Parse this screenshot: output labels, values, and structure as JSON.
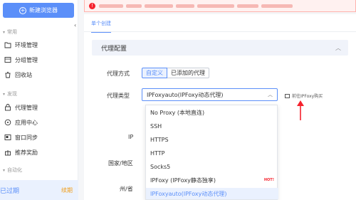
{
  "sidebar": {
    "new_button": "新建浏览器",
    "sections": {
      "common": "常用",
      "discover": "发现",
      "automation": "自动化"
    },
    "items": {
      "env": "环境管理",
      "group": "分组管理",
      "recycle": "回收站",
      "proxy": "代理管理",
      "apps": "应用中心",
      "sync": "窗口同步",
      "referral": "推荐奖励"
    },
    "expire_text": "已过期",
    "renew_label": "续期"
  },
  "main": {
    "tab_label": "单个创建",
    "section_title": "代理配置",
    "proxy_mode_label": "代理方式",
    "proxy_mode_options": [
      "自定义",
      "已添加的代理"
    ],
    "proxy_type_label": "代理类型",
    "proxy_type_value": "IPFoxyauto(IPFoxy动态代理)",
    "buy_link": "前往IPFoxy购买",
    "ip_label": "IP",
    "country_label": "国家/地区",
    "state_label": "州/省",
    "dropdown_options": [
      "No Proxy (本地直连)",
      "SSH",
      "HTTPS",
      "HTTP",
      "Socks5",
      "IPFoxy (IPFoxy静态独享)",
      "IPFoxyauto(IPFoxy动态代理)"
    ],
    "hot_badge": "HOT!"
  },
  "colors": {
    "accent": "#5b8ff9",
    "warning_red": "#f5222d",
    "renew_orange": "#f0a020"
  }
}
